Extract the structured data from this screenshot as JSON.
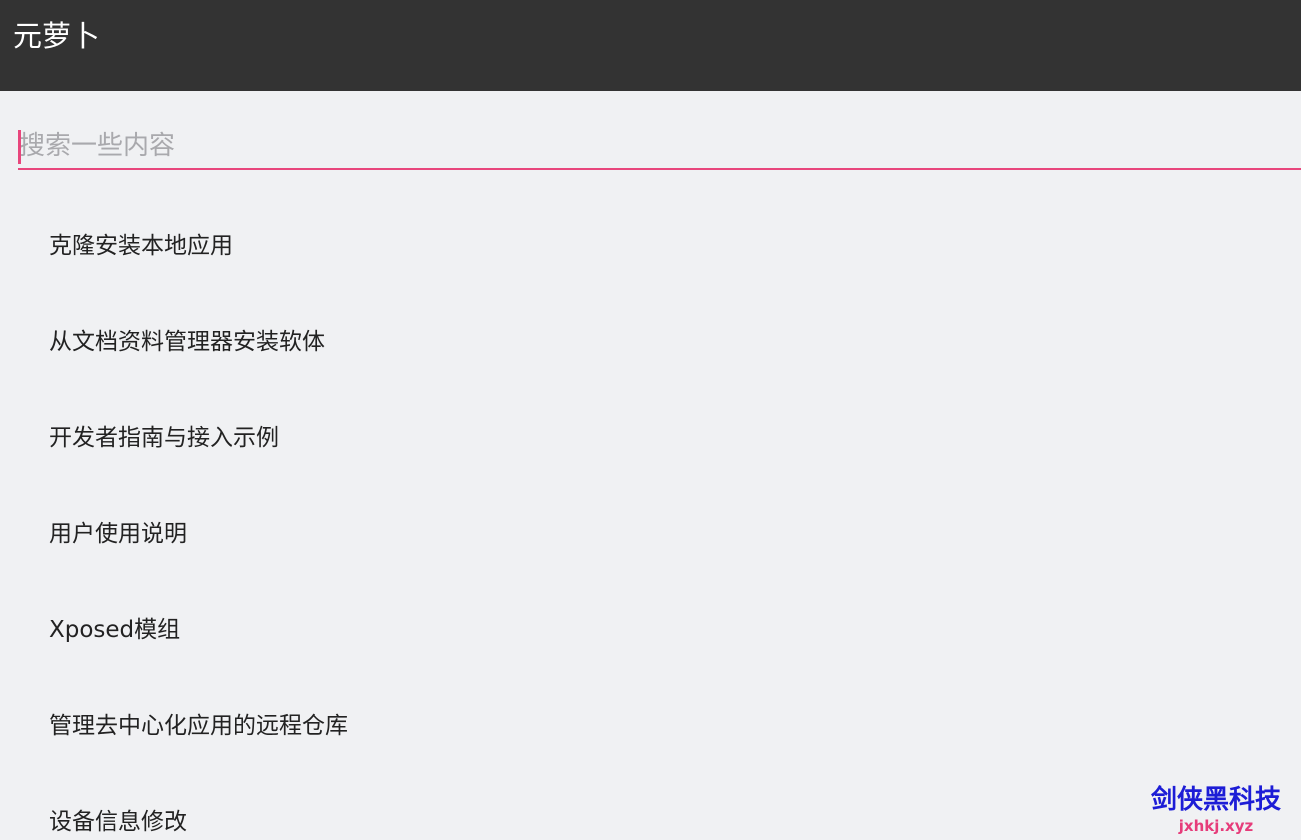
{
  "toolbar": {
    "title": "元萝卜"
  },
  "search": {
    "placeholder": "搜索一些内容",
    "value": ""
  },
  "menu": {
    "items": [
      {
        "label": "克隆安装本地应用"
      },
      {
        "label": "从文档资料管理器安装软体"
      },
      {
        "label": "开发者指南与接入示例"
      },
      {
        "label": "用户使用说明"
      },
      {
        "label": "Xposed模组"
      },
      {
        "label": "管理去中心化应用的远程仓库"
      },
      {
        "label": "设备信息修改"
      }
    ]
  },
  "watermark": {
    "name": "剑侠黑科技",
    "url": "jxhkj.xyz"
  },
  "colors": {
    "toolbar_bg": "#333333",
    "page_bg": "#f0f1f3",
    "accent": "#e8467c",
    "watermark_blue": "#1d1dd6",
    "watermark_pink": "#e63c7a"
  }
}
